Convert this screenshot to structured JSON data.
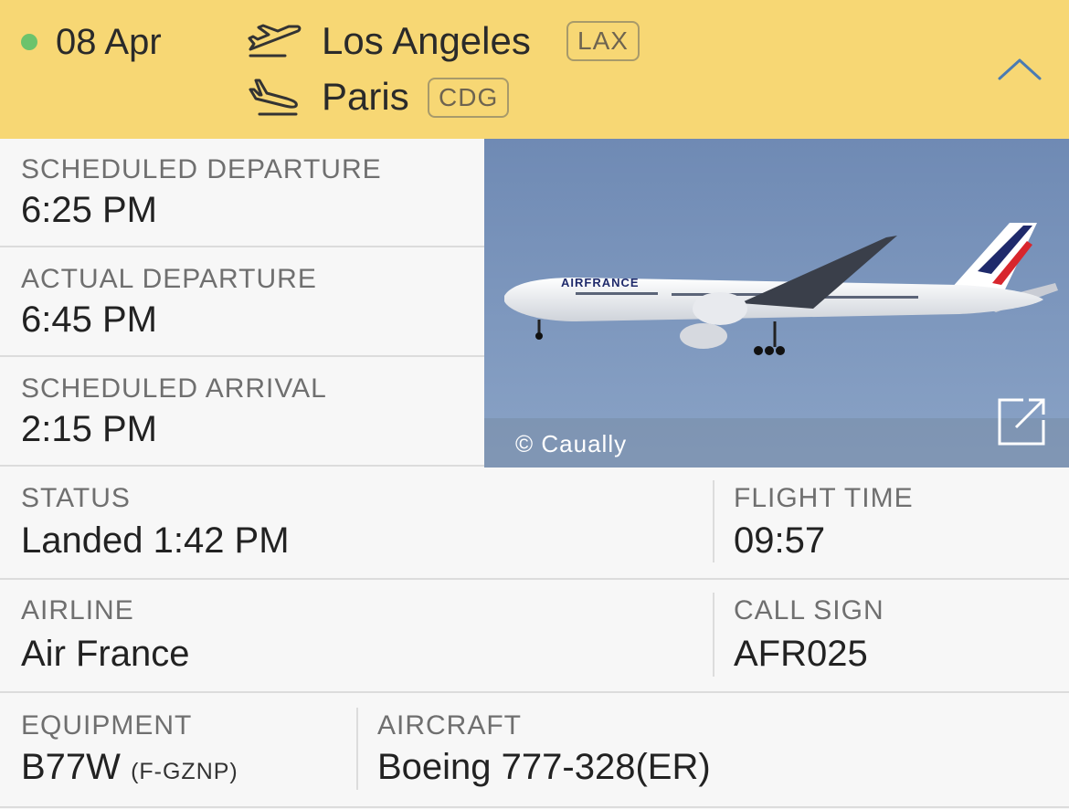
{
  "header": {
    "date": "08 Apr",
    "departure_city": "Los Angeles",
    "departure_code": "LAX",
    "arrival_city": "Paris",
    "arrival_code": "CDG",
    "status_dot_color": "#6cc36c",
    "background_color": "#f7d774"
  },
  "times": [
    {
      "label": "SCHEDULED DEPARTURE",
      "value": "6:25 PM"
    },
    {
      "label": "ACTUAL DEPARTURE",
      "value": "6:45 PM"
    },
    {
      "label": "SCHEDULED ARRIVAL",
      "value": "2:15 PM"
    }
  ],
  "photo": {
    "credit": "© Caually",
    "livery_text": "AIRFRANCE"
  },
  "status": {
    "label": "STATUS",
    "value": "Landed 1:42 PM"
  },
  "flight_time": {
    "label": "FLIGHT TIME",
    "value": "09:57"
  },
  "airline": {
    "label": "AIRLINE",
    "value": "Air France"
  },
  "call_sign": {
    "label": "CALL SIGN",
    "value": "AFR025"
  },
  "equipment": {
    "label": "EQUIPMENT",
    "value": "B77W",
    "registration": "(F-GZNP)"
  },
  "aircraft": {
    "label": "AIRCRAFT",
    "value": "Boeing 777-328(ER)"
  },
  "icons": [
    "departure-plane-icon",
    "arrival-plane-icon",
    "chevron-up-icon",
    "external-link-icon"
  ]
}
